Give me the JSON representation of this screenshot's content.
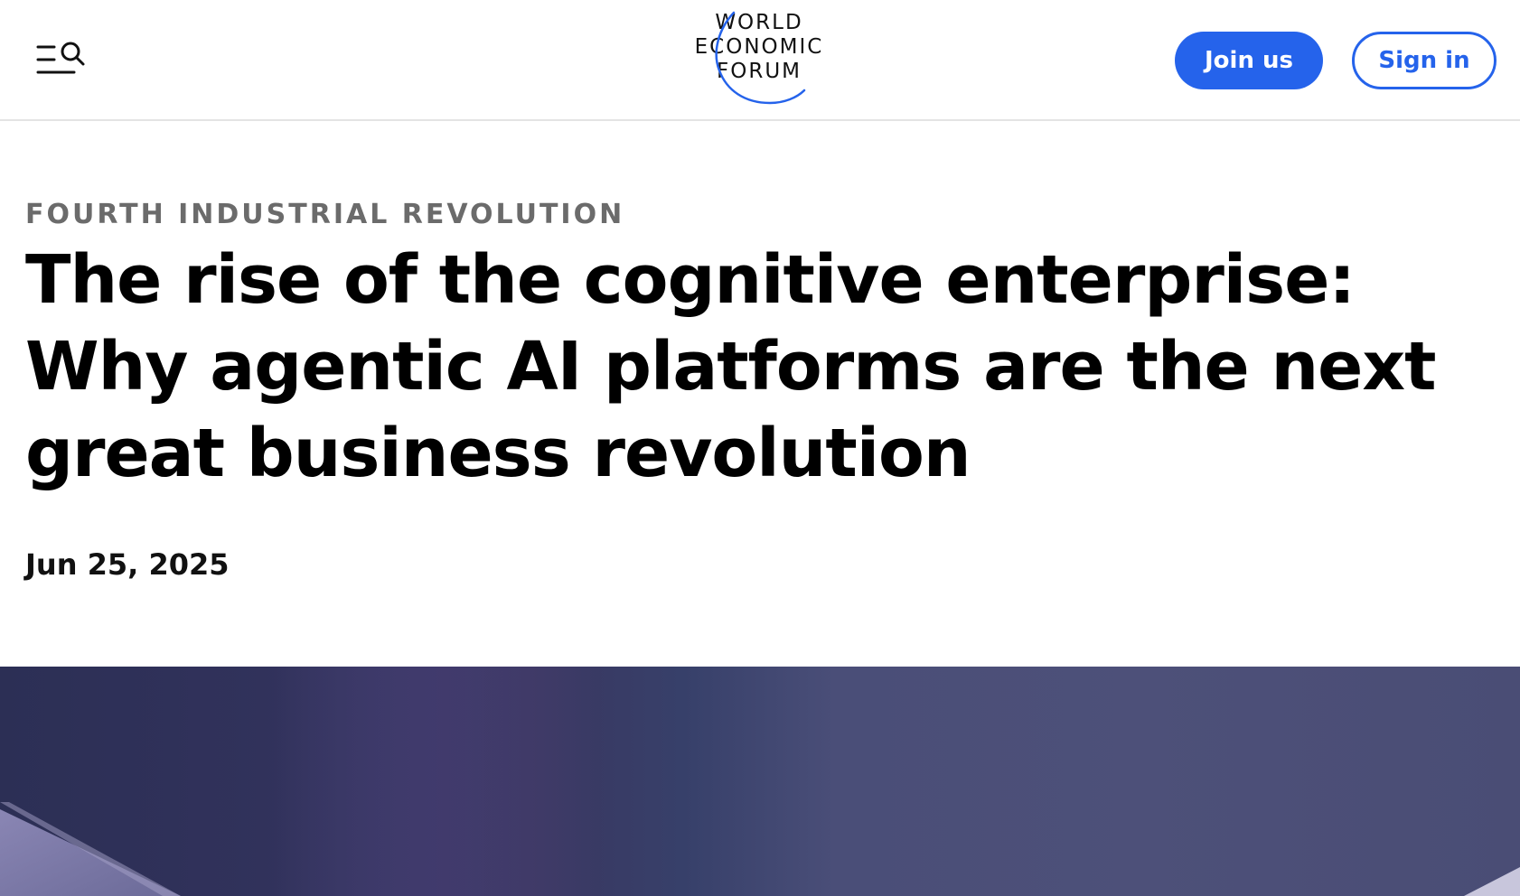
{
  "header": {
    "menu_icon": "menu-search-icon",
    "logo": {
      "lines": [
        "WORLD",
        "ECONOMIC",
        "FORUM"
      ]
    },
    "join_label": "Join us",
    "signin_label": "Sign in"
  },
  "article": {
    "category": "FOURTH INDUSTRIAL REVOLUTION",
    "title": "The rise of the cognitive enterprise: Why agentic AI platforms are the next great business revolution",
    "date": "Jun 25, 2025"
  },
  "colors": {
    "accent": "#2563eb",
    "category_text": "#6b6b6b",
    "hero_dark": "#2c2f55",
    "hero_light": "#4d5079"
  }
}
